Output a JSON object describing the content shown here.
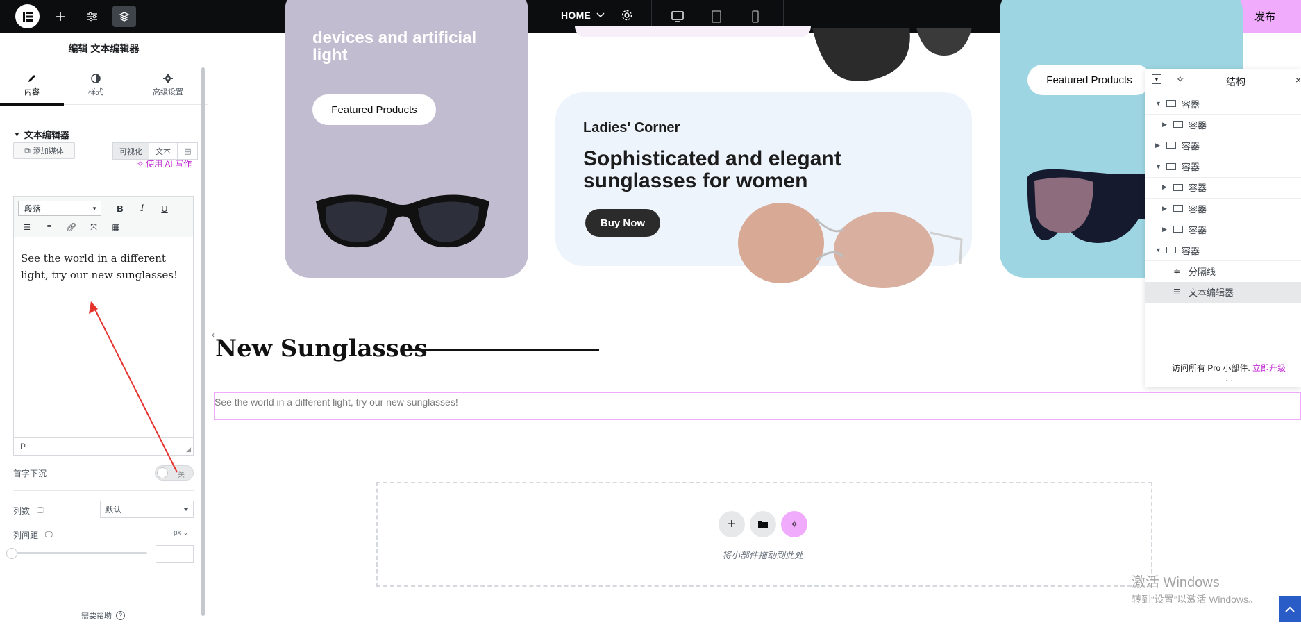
{
  "topbar": {
    "page_name": "HOME",
    "publish_label": "发布"
  },
  "panel": {
    "title": "编辑 文本编辑器",
    "tabs": [
      {
        "label": "内容"
      },
      {
        "label": "样式"
      },
      {
        "label": "高级设置"
      }
    ],
    "section_title": "文本编辑器",
    "ai_link": "使用 AI 写作",
    "add_media": "添加媒体",
    "mode_tabs": [
      "可视化",
      "文本"
    ],
    "paragraph_select": "段落",
    "editor_content": "See the world in a different light, try our new sunglasses!",
    "status_path": "P",
    "drop_cap_label": "首字下沉",
    "drop_cap_value": "关",
    "columns_label": "列数",
    "columns_value": "默认",
    "column_gap_label": "列间距",
    "column_gap_unit": "px",
    "help_label": "需要帮助"
  },
  "canvas": {
    "card_purple": {
      "heading": "devices and artificial light",
      "button": "Featured Products"
    },
    "card_blue": {
      "kicker": "Ladies' Corner",
      "heading": "Sophisticated and elegant sunglasses for women",
      "button": "Buy Now"
    },
    "card_teal": {
      "button": "Featured Products"
    },
    "section_title": "New Sunglasses",
    "selected_text": "See the world in a different light, try our new sunglasses!",
    "drop_zone_text": "将小部件拖动到此处"
  },
  "structure": {
    "title": "结构",
    "rows": [
      {
        "label": "容器",
        "level": 0,
        "expanded": true
      },
      {
        "label": "容器",
        "level": 1,
        "expanded": false
      },
      {
        "label": "容器",
        "level": 0,
        "expanded": false
      },
      {
        "label": "容器",
        "level": 0,
        "expanded": true
      },
      {
        "label": "容器",
        "level": 1,
        "expanded": false
      },
      {
        "label": "容器",
        "level": 1,
        "expanded": false
      },
      {
        "label": "容器",
        "level": 1,
        "expanded": false
      },
      {
        "label": "容器",
        "level": 0,
        "expanded": true
      },
      {
        "label": "分隔线",
        "level": 1
      },
      {
        "label": "文本编辑器",
        "level": 1,
        "selected": true
      }
    ],
    "footer_text": "访问所有 Pro 小部件.",
    "footer_link": "立即升级"
  },
  "watermark": {
    "line1": "激活 Windows",
    "line2": "转到“设置”以激活 Windows。"
  },
  "colors": {
    "accent_pink": "#f0abfc",
    "link_magenta": "#c026d3",
    "topbar_bg": "#0c0d0e",
    "card_purple": "#c1bccf",
    "card_blue": "#eef4fb",
    "card_teal": "#9dd5e2"
  }
}
